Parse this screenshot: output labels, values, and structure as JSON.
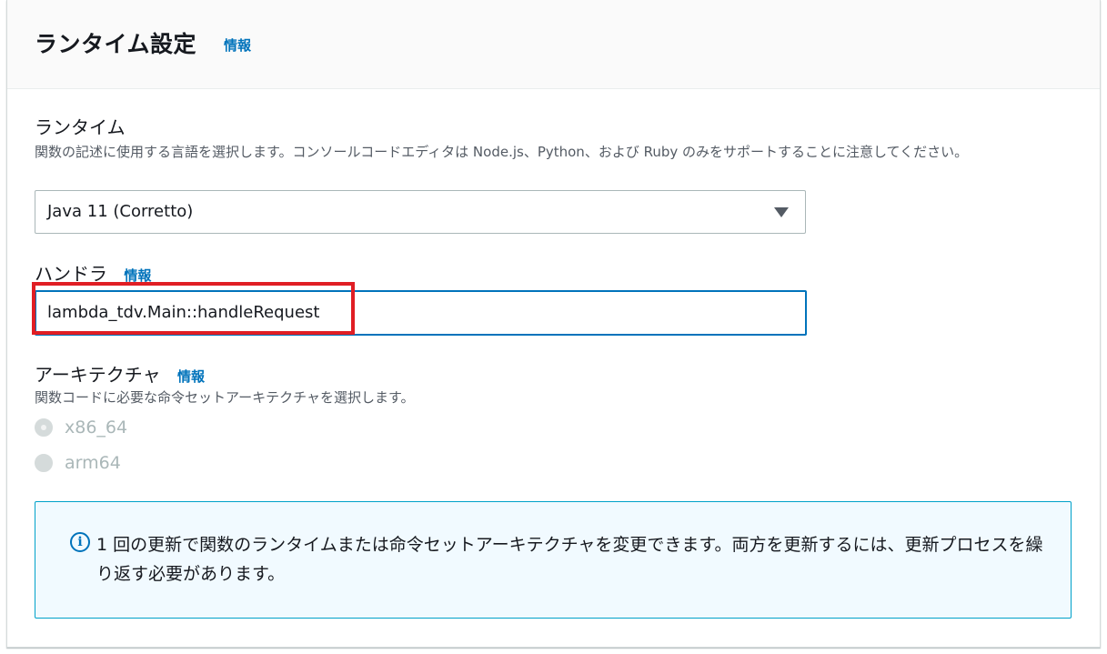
{
  "section": {
    "title": "ランタイム設定",
    "info_label": "情報"
  },
  "runtime": {
    "label": "ランタイム",
    "description": "関数の記述に使用する言語を選択します。コンソールコードエディタは Node.js、Python、および Ruby のみをサポートすることに注意してください。",
    "selected": "Java 11 (Corretto)"
  },
  "handler": {
    "label": "ハンドラ",
    "info_label": "情報",
    "value": "lambda_tdv.Main::handleRequest"
  },
  "architecture": {
    "label": "アーキテクチャ",
    "info_label": "情報",
    "description": "関数コードに必要な命令セットアーキテクチャを選択します。",
    "options": [
      {
        "label": "x86_64",
        "checked": true,
        "disabled": true
      },
      {
        "label": "arm64",
        "checked": false,
        "disabled": true
      }
    ]
  },
  "alert": {
    "icon": "info-icon",
    "text": "1 回の更新で関数のランタイムまたは命令セットアーキテクチャを変更できます。両方を更新するには、更新プロセスを繰り返す必要があります。"
  },
  "colors": {
    "link": "#0073bb",
    "highlight": "#e01e24",
    "alert_bg": "#f1faff",
    "alert_border": "#00a1c9"
  }
}
